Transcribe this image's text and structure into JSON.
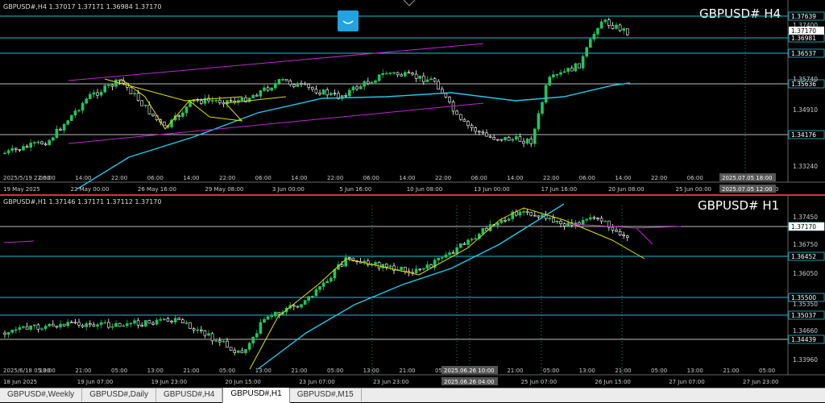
{
  "top": {
    "info": "GBPUSD#,H4  1.37017 1.37171 1.36984 1.37170",
    "title": "GBPUSD# H4",
    "price_labels": [
      "1.37639",
      "1.37400",
      "1.37170",
      "1.36981",
      "1.36537",
      "1.35740",
      "1.35636",
      "1.34910",
      "1.34176",
      "1.33240"
    ],
    "level_labels": [
      "1.37639",
      "1.36981",
      "1.36537",
      "1.35636",
      "1.34176"
    ],
    "plain_labels": [
      "1.37400",
      "1.35740",
      "1.34910",
      "1.33240"
    ],
    "current_price": "1.37170",
    "time_top_row": [
      "2025/5/19 22:00",
      "06:00",
      "14:00",
      "22:00",
      "06:00",
      "14:00",
      "22:00",
      "06:00",
      "14:00",
      "22:00",
      "06:00",
      "14:00",
      "22:00",
      "06:00",
      "14:00",
      "22:00",
      "06:00",
      "14:00",
      "22:00",
      "06:00",
      "14:00",
      "22:00"
    ],
    "time_bottom_row": [
      "19 May 2025",
      "22 May 00:00",
      "26 May 16:00",
      "29 May 08:00",
      "3 Jun 00:00",
      "5 Jun 16:00",
      "10 Jun 08:00",
      "13 Jun 00:00",
      "17 Jun 16:00",
      "20 Jun 08:00",
      "25 Jun 00:00",
      "27 Jun 16:00"
    ],
    "cursor_time_1": "2025.07.05 18:00",
    "cursor_time_2": "2025.07.05 12:00"
  },
  "bottom": {
    "info": "GBPUSD#,H1  1.37146 1.37171 1.37112 1.37170",
    "title": "GBPUSD# H1",
    "level_labels": [
      "1.37170",
      "1.36452",
      "1.35500",
      "1.35037",
      "1.34439"
    ],
    "plain_labels": [
      "1.37450",
      "1.36750",
      "1.36050",
      "1.35350",
      "1.34660",
      "1.33960"
    ],
    "time_top_row": [
      "2025/6/18 05:00",
      "13:00",
      "21:00",
      "05:00",
      "13:00",
      "21:00",
      "05:00",
      "13:00",
      "21:00",
      "05:00",
      "13:00",
      "21:00",
      "05:00",
      "13:00",
      "21:00",
      "05:00",
      "13:00",
      "21:00",
      "05:00",
      "13:00",
      "21:00",
      "05:00"
    ],
    "time_bottom_row": [
      "18 Jun 2025",
      "19 Jun 07:00",
      "19 Jun 23:00",
      "20 Jun 15:00",
      "23 Jun 07:00",
      "23 Jun 23:00",
      "24 Jun 15:00",
      "25 Jun 07:00",
      "26 Jun 15:00",
      "27 Jun 07:00",
      "27 Jun 23:00"
    ],
    "cursor_time_1": "2025.06.26 10:00",
    "cursor_time_2": "2025.06.26 04:00"
  },
  "tabs": [
    "GBPUSD#,Weekly",
    "GBPUSD#,Daily",
    "GBPUSD#,H4",
    "GBPUSD#,H1",
    "GBPUSD#,M15"
  ],
  "active_tab": "GBPUSD#,H1",
  "colors": {
    "background": "#000000",
    "bull_candle": "#22c55e",
    "bear_candle": "#ffffff",
    "level_line": "#16c5d8",
    "ma_line": "#22c9e8",
    "trend_line": "#e0e000",
    "channel_line": "#c026d3",
    "separator": "#dd3333"
  },
  "icons": [
    "chart-app-icon",
    "collapse-arrow-icon"
  ]
}
